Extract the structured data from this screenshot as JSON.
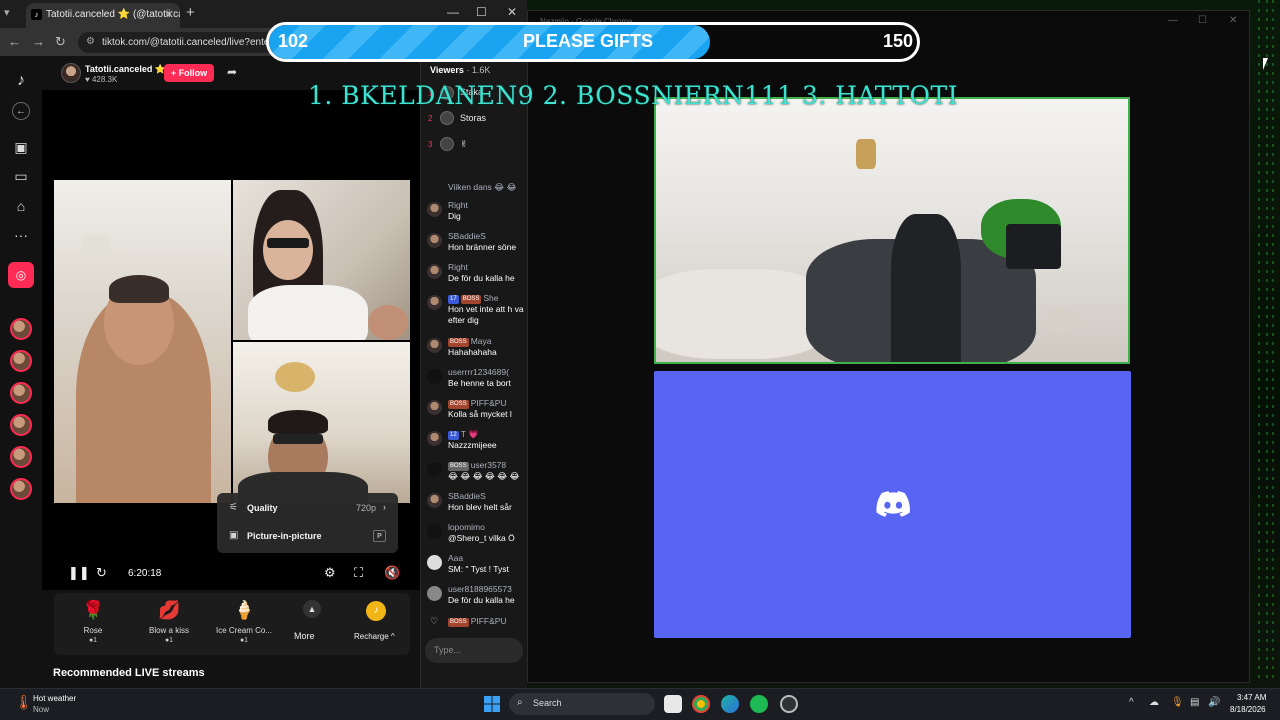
{
  "chrome": {
    "tab_title": "Tatotii.canceled ⭐ (@tatotii.ca",
    "tab_close": "✕",
    "new_tab": "+",
    "url": "tiktok.com/@tatotii.canceled/live?enter_"
  },
  "window": {
    "minimize": "—",
    "maximize": "☐",
    "close": "✕"
  },
  "live": {
    "host_name": "Tatotii.canceled ⭐",
    "host_likes": "♥ 428.3K",
    "follow_label": "+ Follow",
    "time": "6:20:18",
    "quality_label": "Quality",
    "quality_value": "720p",
    "pip_label": "Picture-in-picture",
    "pip_key": "P",
    "recommended": "Recommended LIVE streams"
  },
  "gifts": [
    {
      "name": "Rose",
      "price": "●1",
      "icon": "🌹"
    },
    {
      "name": "Blow a kiss",
      "price": "●1",
      "icon": "💋"
    },
    {
      "name": "Ice Cream Co...",
      "price": "●1",
      "icon": "🍦"
    }
  ],
  "gift_more": "More",
  "gift_recharge": "Recharge ^",
  "viewers": {
    "label": "Viewers",
    "count": "· 1.6K"
  },
  "top_viewers": [
    {
      "rank": "1",
      "name": "Staka"
    },
    {
      "rank": "2",
      "name": "Storas"
    },
    {
      "rank": "3",
      "name": "✌"
    }
  ],
  "chat": [
    {
      "name": "Viiken dans 😂 😂",
      "text": ""
    },
    {
      "name": "Right",
      "text": "Dig"
    },
    {
      "name": "SBaddieS",
      "text": "Hon bränner söne"
    },
    {
      "name": "Right",
      "text": "De för du kalla he"
    },
    {
      "badge1": "17",
      "badge2": "BOSS",
      "name": "She",
      "text": "Hon vet inte att h va efter dig"
    },
    {
      "badge2": "BOSS",
      "name": "Maya",
      "text": "Hahahahaha"
    },
    {
      "name": "userrrr1234689(",
      "text": "Be henne ta bort"
    },
    {
      "badge2": "BOSS",
      "name": "PIFF&PU",
      "text": "Kolla så mycket l"
    },
    {
      "badge1": "12",
      "name": "T 💗",
      "text": "Nazzzmijeee"
    },
    {
      "badge3": "BOSS",
      "name": "user3578",
      "text": "😂 😂 😂 😂 😂 😂"
    },
    {
      "name": "SBaddieS",
      "text": "Hon blev helt sår"
    },
    {
      "name": "lopomimo",
      "text": "@Shero_t vilka Ö"
    },
    {
      "name": "Aaa",
      "text": "SM: \" Tyst ! Tyst"
    },
    {
      "name": "user8188965573",
      "text": "De för du kalla he"
    },
    {
      "badge2": "BOSS",
      "name": "PIFF&PU",
      "text": ""
    }
  ],
  "chat_input_placeholder": "Type...",
  "win2": {
    "title": "Nazmijo - Google Chrome"
  },
  "overlay": {
    "progress_current": 102,
    "progress_goal": 150,
    "progress_current_label": "102",
    "progress_goal_label": "150",
    "progress_label": "PLEASE GIFTS",
    "top_gifters": "1. BKELDANEN9  2. BOSSNIERN111  3. HATTOTI"
  },
  "taskbar": {
    "weather_title": "Hot weather",
    "weather_sub": "Now",
    "search": "Search",
    "time": "3:47 AM",
    "date": "8/18/2026"
  },
  "colors": {
    "tiktok_red": "#fe2c55",
    "discord": "#5865f2",
    "cam_border": "#3fb04a",
    "progress": "#1aa3f0",
    "gifter_text": "#3de3cf"
  }
}
